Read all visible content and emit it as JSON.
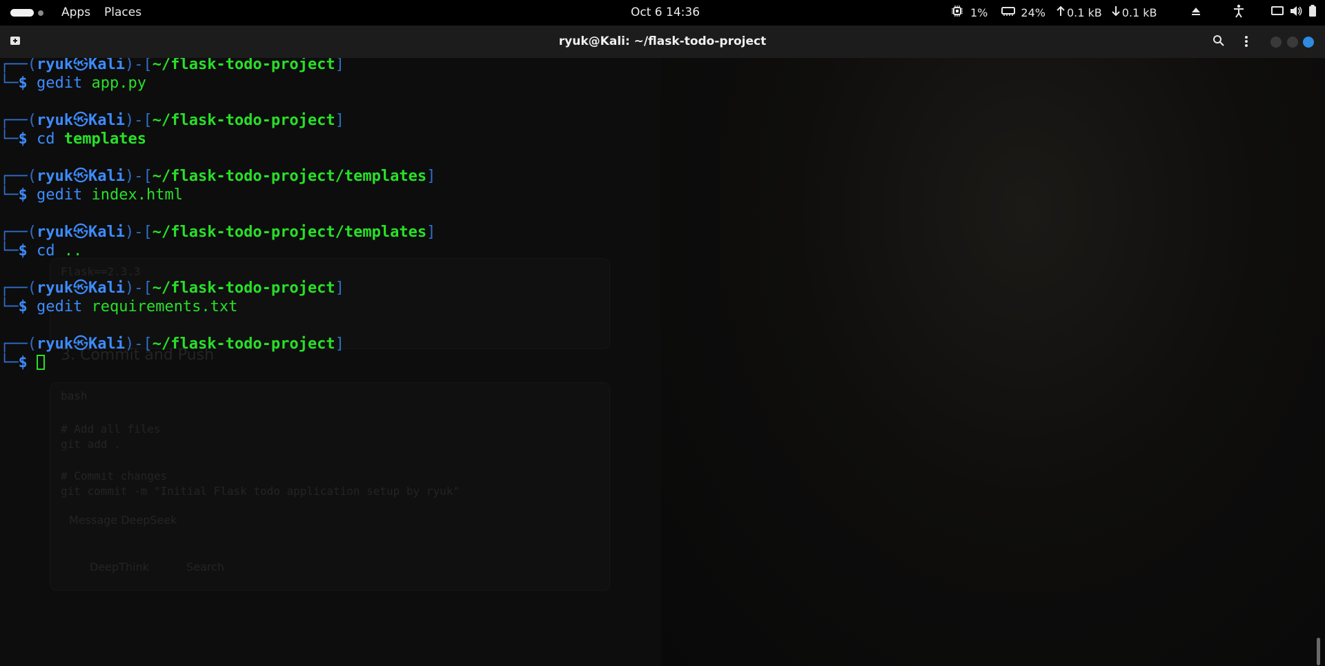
{
  "topbar": {
    "apps_label": "Apps",
    "places_label": "Places",
    "clock": "Oct 6  14:36",
    "cpu": "1%",
    "mem": "24%",
    "net_up": "0.1 kB",
    "net_down": "0.1 kB"
  },
  "window": {
    "title": "ryuk@Kali: ~/flask-todo-project"
  },
  "terminal": {
    "user": "ryuk",
    "host": "Kali",
    "prompts": [
      {
        "path": "~/flask-todo-project",
        "cmd": "gedit",
        "arg": "app.py"
      },
      {
        "path": "~/flask-todo-project",
        "cmd": "cd",
        "arg": "templates"
      },
      {
        "path": "~/flask-todo-project/templates",
        "cmd": "gedit",
        "arg": "index.html"
      },
      {
        "path": "~/flask-todo-project/templates",
        "cmd": "cd",
        "arg": ".."
      },
      {
        "path": "~/flask-todo-project",
        "cmd": "gedit",
        "arg": "requirements.txt"
      },
      {
        "path": "~/flask-todo-project",
        "cmd": "",
        "arg": ""
      }
    ]
  },
  "background_ghost": {
    "lines": [
      "Flask==2.3.3",
      "3. Commit and Push",
      "bash",
      "# Add all files",
      "git add .",
      "# Commit changes",
      "git commit -m \"Initial Flask todo application setup by ryuk\"",
      "Message DeepSeek",
      "DeepThink",
      "Search"
    ]
  },
  "colors": {
    "prompt_blue": "#3d8cff",
    "path_green": "#28e028",
    "close_button": "#2f8ae0"
  }
}
